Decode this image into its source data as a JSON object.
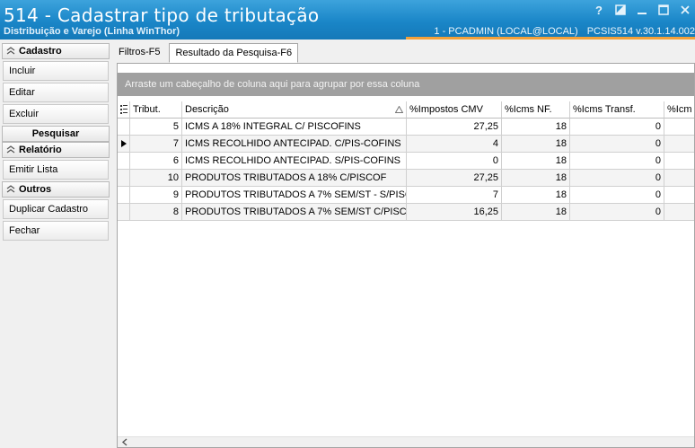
{
  "window": {
    "title": "514 - Cadastrar tipo de tributação",
    "subtitle": "Distribuição e Varejo (Linha WinThor)",
    "user_info": "1 - PCADMIN (LOCAL@LOCAL)",
    "version_info": "PCSIS514  v.30.1.14.002",
    "help_label": "?"
  },
  "sidebar": {
    "cadastro": {
      "title": "Cadastro",
      "items": [
        "Incluir",
        "Editar",
        "Excluir"
      ]
    },
    "pesquisar": {
      "title": "Pesquisar"
    },
    "relatorio": {
      "title": "Relatório",
      "items": [
        "Emitir Lista"
      ]
    },
    "outros": {
      "title": "Outros",
      "items": [
        "Duplicar Cadastro",
        "Fechar"
      ]
    }
  },
  "tabs": [
    "Filtros-F5",
    "Resultado da Pesquisa-F6"
  ],
  "group_panel_text": "Arraste um cabeçalho de coluna aqui para agrupar por essa coluna",
  "grid": {
    "columns": [
      "Tribut.",
      "Descrição",
      "%Impostos CMV",
      "%Icms NF.",
      "%Icms Transf.",
      "%Icm"
    ],
    "rows": [
      [
        "5",
        "ICMS A 18% INTEGRAL C/ PISCOFINS",
        "27,25",
        "18",
        "0"
      ],
      [
        "7",
        "ICMS RECOLHIDO ANTECIPAD. C/PIS-COFINS",
        "4",
        "18",
        "0"
      ],
      [
        "6",
        "ICMS RECOLHIDO ANTECIPAD. S/PIS-COFINS",
        "0",
        "18",
        "0"
      ],
      [
        "10",
        "PRODUTOS TRIBUTADOS A 18%  C/PISCOF",
        "27,25",
        "18",
        "0"
      ],
      [
        "9",
        "PRODUTOS TRIBUTADOS A 7% SEM/ST - S/PISC",
        "7",
        "18",
        "0"
      ],
      [
        "8",
        "PRODUTOS TRIBUTADOS A 7% SEM/ST C/PISCOF",
        "16,25",
        "18",
        "0"
      ]
    ],
    "current_row": 1
  },
  "colors": {
    "titlebar": "#1a86c8",
    "accent": "#f3a13a",
    "group_panel": "#a0a0a0"
  }
}
